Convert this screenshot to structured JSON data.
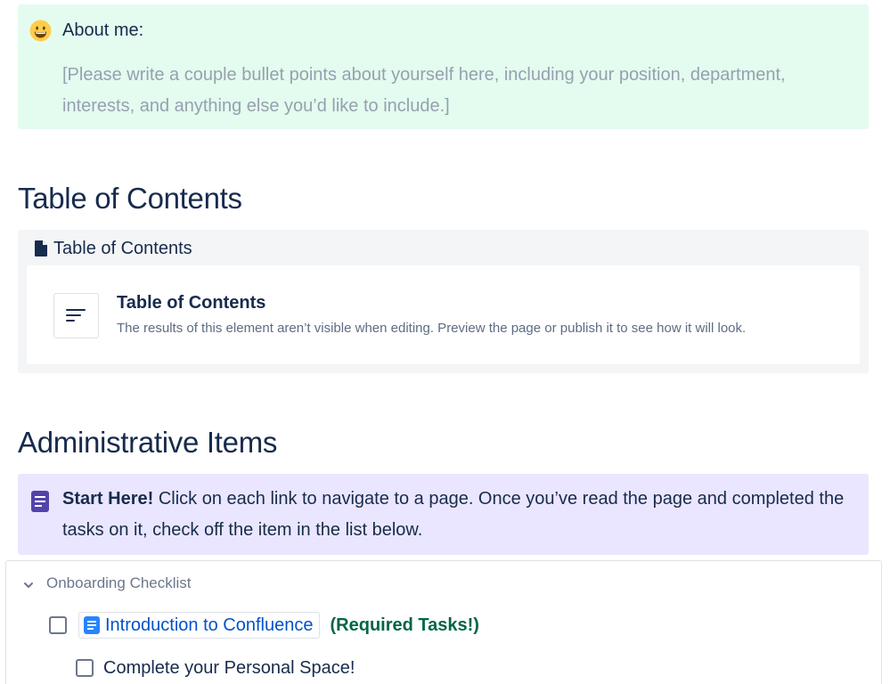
{
  "about": {
    "emoji": "grinning-face-icon",
    "title": "About me:",
    "body": "[Please write a couple bullet points about yourself here, including your position, department, interests, and anything else you’d like to include.]",
    "background": "#E3FCEF"
  },
  "toc_heading": "Table of Contents",
  "toc_macro": {
    "icon": "document-icon",
    "title": "Table of Contents",
    "card": {
      "icon": "toc-lines-icon",
      "title": "Table of Contents",
      "description": "The results of this element aren’t visible when editing. Preview the page or publish it to see how it will look."
    }
  },
  "admin_heading": "Administrative Items",
  "start_panel": {
    "icon": "note-icon",
    "bold": "Start Here!",
    "text": " Click on each link to navigate to a page. Once you’ve read the page and completed the tasks on it, check off the item in the list below.",
    "background": "#EAE6FF"
  },
  "expand": {
    "icon": "chevron-down-icon",
    "title": "Onboarding Checklist",
    "tasks": [
      {
        "link_icon": "page-icon",
        "link_text": "Introduction to Confluence",
        "note": "(Required Tasks!)",
        "checked": false
      },
      {
        "text": "Complete your Personal Space!",
        "checked": false
      }
    ]
  },
  "colors": {
    "text": "#172B4D",
    "link": "#0052CC",
    "required": "#006644",
    "placeholder": "#97A0AF"
  }
}
